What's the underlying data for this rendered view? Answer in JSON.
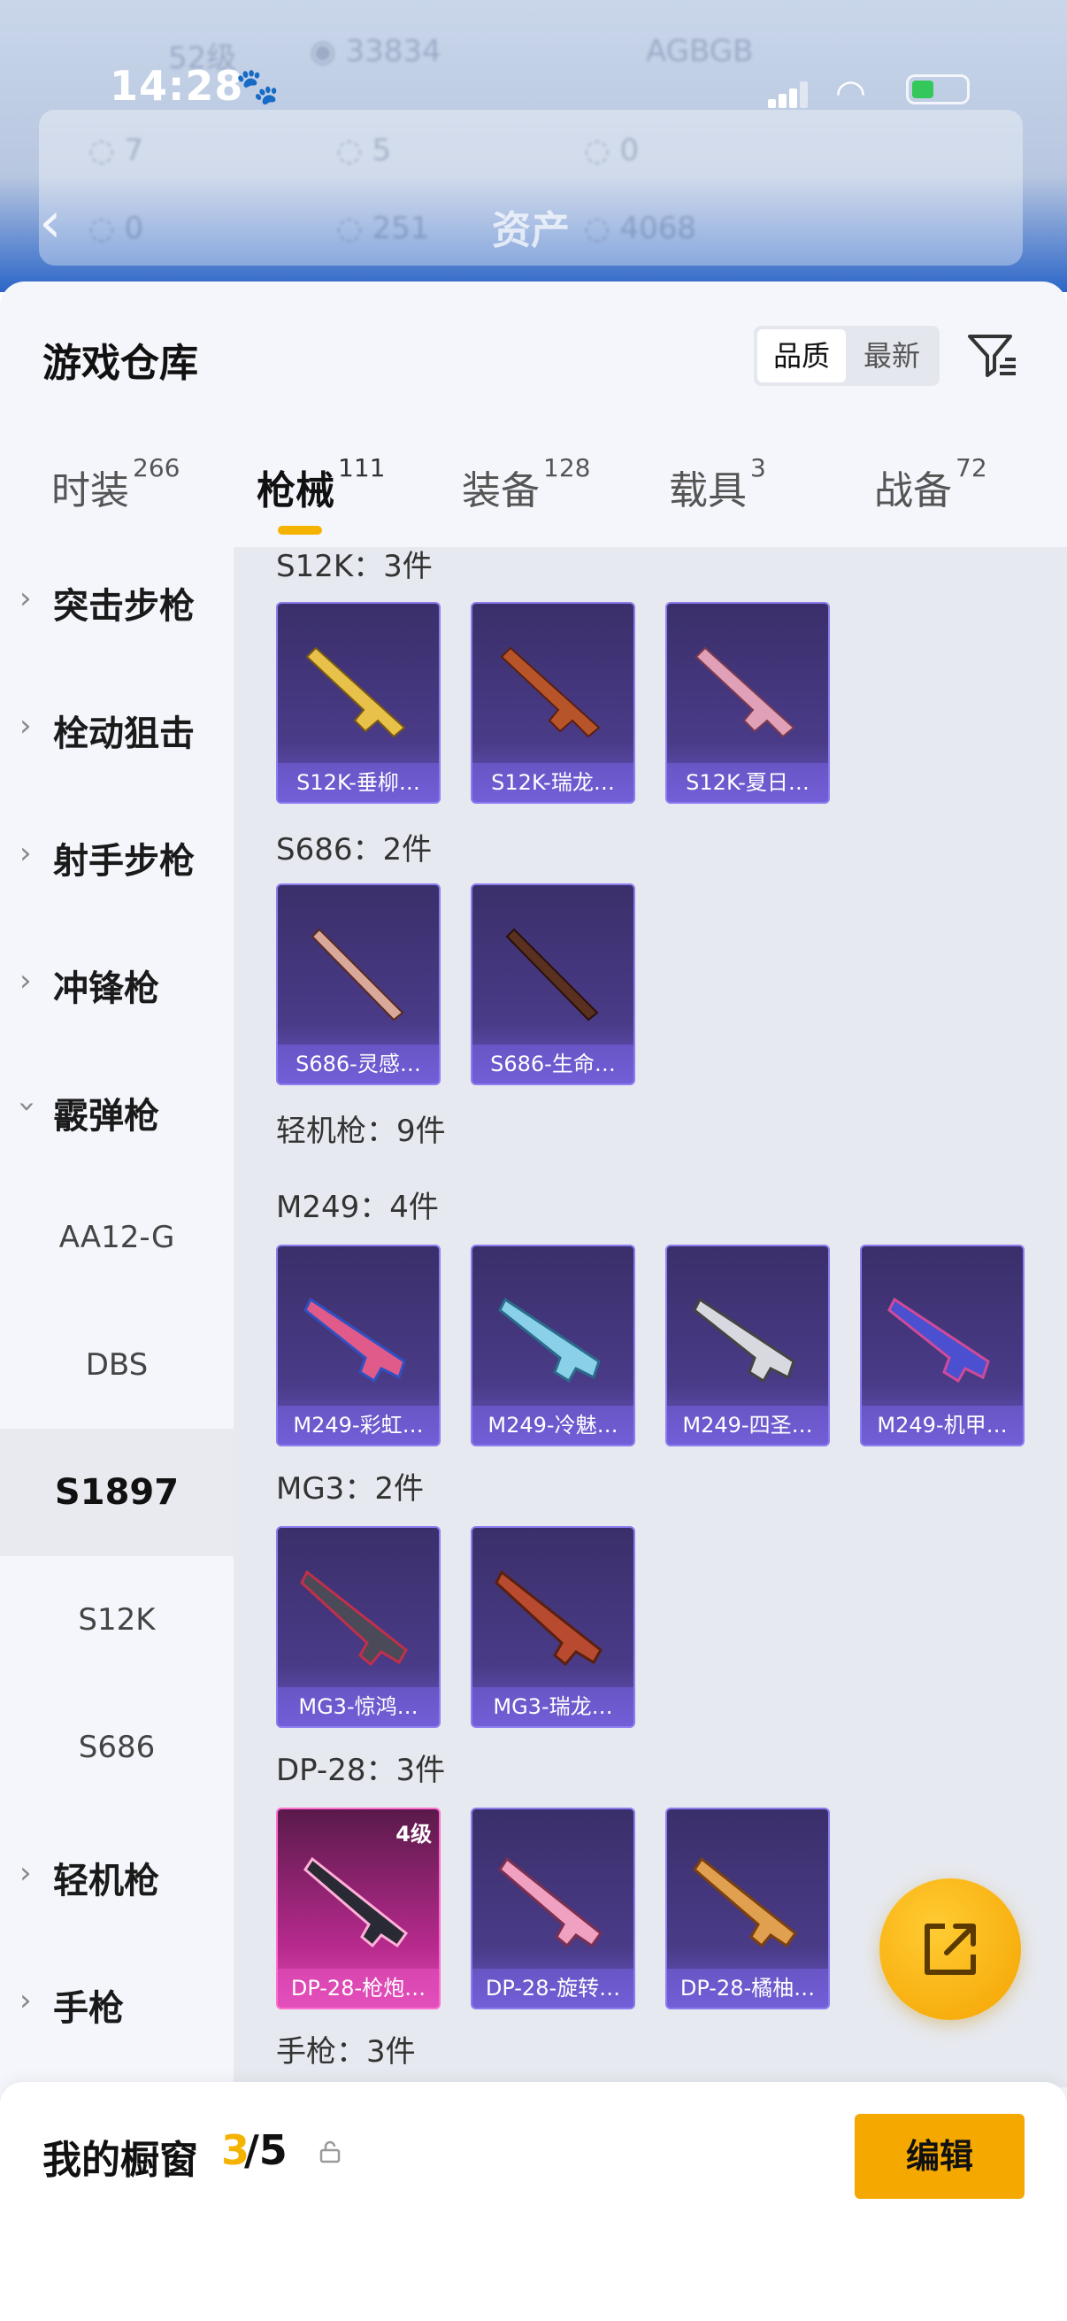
{
  "status_bar": {
    "time": "14:28"
  },
  "backdrop": {
    "title": "资产"
  },
  "header": {
    "title": "游戏仓库",
    "sort": {
      "quality": "品质",
      "newest": "最新"
    }
  },
  "tabs": [
    {
      "label": "时装",
      "count": "266"
    },
    {
      "label": "枪械",
      "count": "111"
    },
    {
      "label": "装备",
      "count": "128"
    },
    {
      "label": "载具",
      "count": "3"
    },
    {
      "label": "战备",
      "count": "72"
    }
  ],
  "sidenav": {
    "assault": "突击步枪",
    "bolt": "栓动狙击",
    "marksman": "射手步枪",
    "smg": "冲锋枪",
    "shotgun": "霰弹枪",
    "aa12": "AA12-G",
    "dbs": "DBS",
    "s1897": "S1897",
    "s12k": "S12K",
    "s686": "S686",
    "lmg": "轻机枪",
    "pistol": "手枪"
  },
  "sections": {
    "s12k": "S12K：3件",
    "s686": "S686：2件",
    "lmg": "轻机枪：9件",
    "m249": "M249：4件",
    "mg3": "MG3：2件",
    "dp28": "DP-28：3件",
    "pistol": "手枪：3件"
  },
  "items": {
    "s12k_1": "S12K-垂柳…",
    "s12k_2": "S12K-瑞龙…",
    "s12k_3": "S12K-夏日…",
    "s686_1": "S686-灵感…",
    "s686_2": "S686-生命…",
    "m249_1": "M249-彩虹…",
    "m249_2": "M249-冷魅…",
    "m249_3": "M249-四圣…",
    "m249_4": "M249-机甲…",
    "mg3_1": "MG3-惊鸿…",
    "mg3_2": "MG3-瑞龙…",
    "dp28_1": "DP-28-枪炮…",
    "dp28_1_level": "4级",
    "dp28_2": "DP-28-旋转…",
    "dp28_3": "DP-28-橘柚…"
  },
  "bottom": {
    "label": "我的橱窗",
    "current": "3",
    "total": "/5",
    "edit": "编辑"
  },
  "colors": {
    "accent": "#f5b301",
    "card": "#4a3b88",
    "rare": "#b82a8e"
  }
}
